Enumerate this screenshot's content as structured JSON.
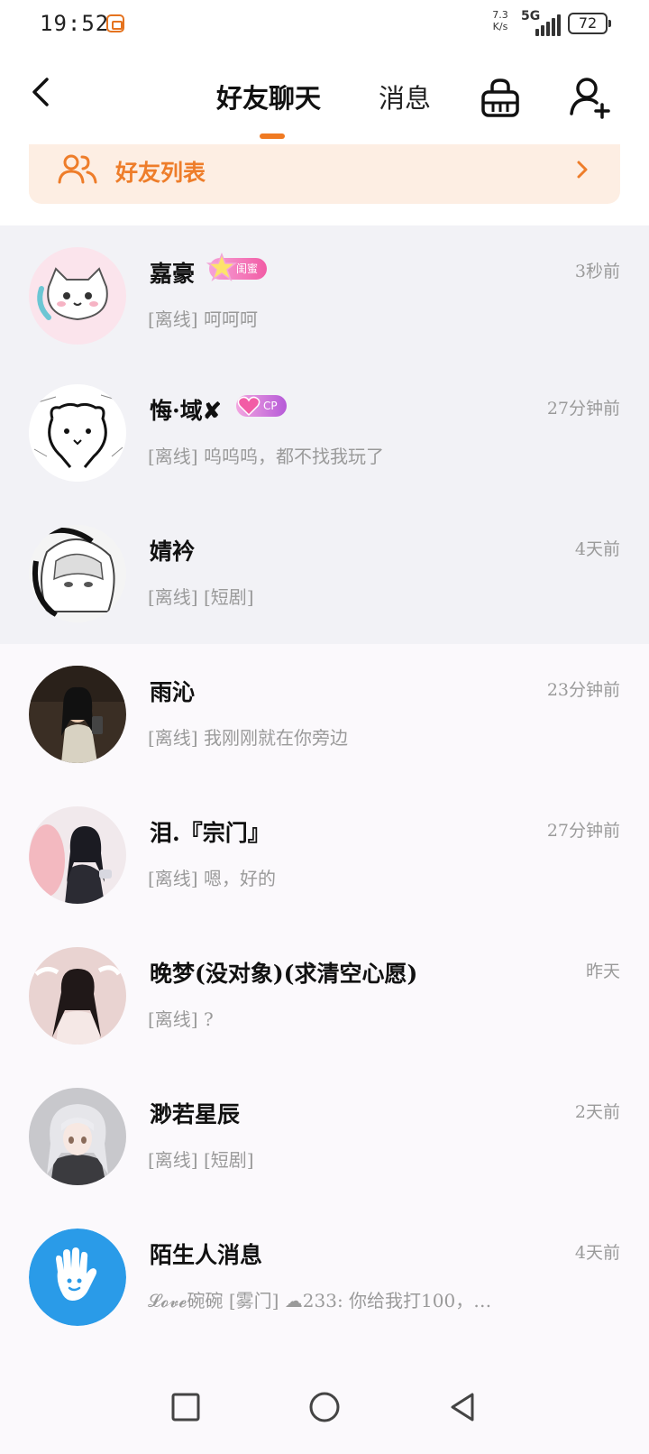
{
  "status_bar": {
    "time": "19:52",
    "speed_value": "7.3",
    "speed_unit": "K/s",
    "network": "5G",
    "battery": "72"
  },
  "header": {
    "tabs": [
      {
        "label": "好友聊天",
        "active": true
      },
      {
        "label": "消息",
        "active": false
      }
    ],
    "icons": {
      "back": "back-arrow-icon",
      "shop": "shop-basket-icon",
      "add_friend": "add-user-icon"
    }
  },
  "friend_banner": {
    "label": "好友列表",
    "accent_color": "#ee7d2a",
    "icon": "friends-icon"
  },
  "conversations": [
    {
      "name": "嘉豪",
      "badge": "闺蜜",
      "time": "3秒前",
      "preview": "[离线] 呵呵呵",
      "pinned": true
    },
    {
      "name": "悔·域✘",
      "badge": "CP",
      "time": "27分钟前",
      "preview": "[离线] 呜呜呜，都不找我玩了",
      "pinned": true
    },
    {
      "name": "婧衿",
      "time": "4天前",
      "preview": "[离线] [短剧]",
      "pinned": true
    },
    {
      "name": "雨沁",
      "time": "23分钟前",
      "preview": "[离线] 我刚刚就在你旁边",
      "pinned": false
    },
    {
      "name": "泪.『宗门』",
      "time": "27分钟前",
      "preview": "[离线] 嗯，好的",
      "pinned": false
    },
    {
      "name": "晚梦(没对象)(求清空心愿)",
      "time": "昨天",
      "preview": "[离线] ?",
      "pinned": false
    },
    {
      "name": "渺若星辰",
      "time": "2天前",
      "preview": "[离线] [短剧]",
      "pinned": false
    },
    {
      "name": "陌生人消息",
      "time": "4天前",
      "preview": "𝓛𝓸𝓿𝓮碗碗 [雾门] ☁︎233: 你给我打100，…",
      "pinned": false
    }
  ],
  "nav": {
    "recent": "square-icon",
    "home": "circle-icon",
    "back": "triangle-back-icon"
  }
}
